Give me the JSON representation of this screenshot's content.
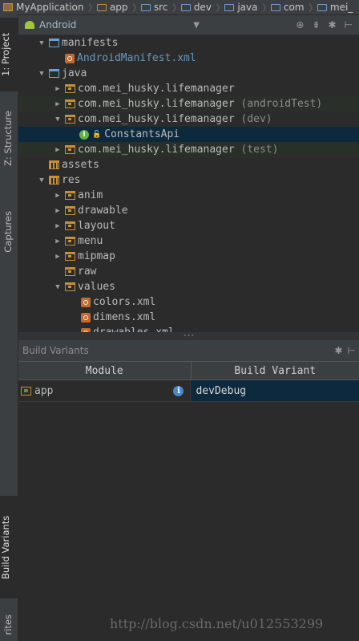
{
  "breadcrumbs": [
    "MyApplication",
    "app",
    "src",
    "dev",
    "java",
    "com",
    "mei_"
  ],
  "tool_tabs": {
    "project": "1: Project",
    "structure": "Z: Structure",
    "captures": "Captures",
    "build_variants": "Build Variants",
    "favorites": "rites"
  },
  "project_panel": {
    "view": "Android",
    "tools": [
      "⊕",
      "⇟",
      "✱",
      "⊢"
    ]
  },
  "tree": [
    {
      "label": "manifests",
      "suffix": "",
      "depth": 1,
      "arrow": "down",
      "icon": "folder-blue",
      "style": ""
    },
    {
      "label": "AndroidManifest.xml",
      "suffix": "",
      "depth": 2,
      "arrow": "none",
      "icon": "xml",
      "style": "link"
    },
    {
      "label": "java",
      "suffix": "",
      "depth": 1,
      "arrow": "down",
      "icon": "folder-blue",
      "style": ""
    },
    {
      "label": "com.mei_husky.lifemanager",
      "suffix": "",
      "depth": 2,
      "arrow": "right",
      "icon": "package",
      "style": ""
    },
    {
      "label": "com.mei_husky.lifemanager",
      "suffix": " (androidTest)",
      "depth": 2,
      "arrow": "right",
      "icon": "package",
      "style": "tinted"
    },
    {
      "label": "com.mei_husky.lifemanager",
      "suffix": " (dev)",
      "depth": 2,
      "arrow": "down",
      "icon": "package",
      "style": ""
    },
    {
      "label": "ConstantsApi",
      "suffix": "",
      "depth": 3,
      "arrow": "none",
      "icon": "interface",
      "style": "selected"
    },
    {
      "label": "com.mei_husky.lifemanager",
      "suffix": " (test)",
      "depth": 2,
      "arrow": "right",
      "icon": "package",
      "style": "tinted"
    },
    {
      "label": "assets",
      "suffix": "",
      "depth": 1,
      "arrow": "none",
      "icon": "res-folder",
      "style": ""
    },
    {
      "label": "res",
      "suffix": "",
      "depth": 1,
      "arrow": "down",
      "icon": "res-folder",
      "style": ""
    },
    {
      "label": "anim",
      "suffix": "",
      "depth": 2,
      "arrow": "right",
      "icon": "package",
      "style": ""
    },
    {
      "label": "drawable",
      "suffix": "",
      "depth": 2,
      "arrow": "right",
      "icon": "package",
      "style": ""
    },
    {
      "label": "layout",
      "suffix": "",
      "depth": 2,
      "arrow": "right",
      "icon": "package",
      "style": ""
    },
    {
      "label": "menu",
      "suffix": "",
      "depth": 2,
      "arrow": "right",
      "icon": "package",
      "style": ""
    },
    {
      "label": "mipmap",
      "suffix": "",
      "depth": 2,
      "arrow": "right",
      "icon": "package",
      "style": ""
    },
    {
      "label": "raw",
      "suffix": "",
      "depth": 2,
      "arrow": "none",
      "icon": "package",
      "style": ""
    },
    {
      "label": "values",
      "suffix": "",
      "depth": 2,
      "arrow": "down",
      "icon": "package",
      "style": ""
    },
    {
      "label": "colors.xml",
      "suffix": "",
      "depth": 3,
      "arrow": "none",
      "icon": "xml",
      "style": ""
    },
    {
      "label": "dimens.xml",
      "suffix": "",
      "depth": 3,
      "arrow": "none",
      "icon": "xml",
      "style": ""
    },
    {
      "label": "drawables.xml",
      "suffix": "",
      "depth": 3,
      "arrow": "none",
      "icon": "xml",
      "style": ""
    }
  ],
  "build_variants": {
    "title": "Build Variants",
    "columns": [
      "Module",
      "Build Variant"
    ],
    "rows": [
      {
        "module": "app",
        "variant": "devDebug"
      }
    ]
  },
  "watermark": "http://blog.csdn.net/u012553299",
  "colors": {
    "selection": "#0d293e",
    "link": "#6897bb",
    "background": "#2b2b2b"
  }
}
